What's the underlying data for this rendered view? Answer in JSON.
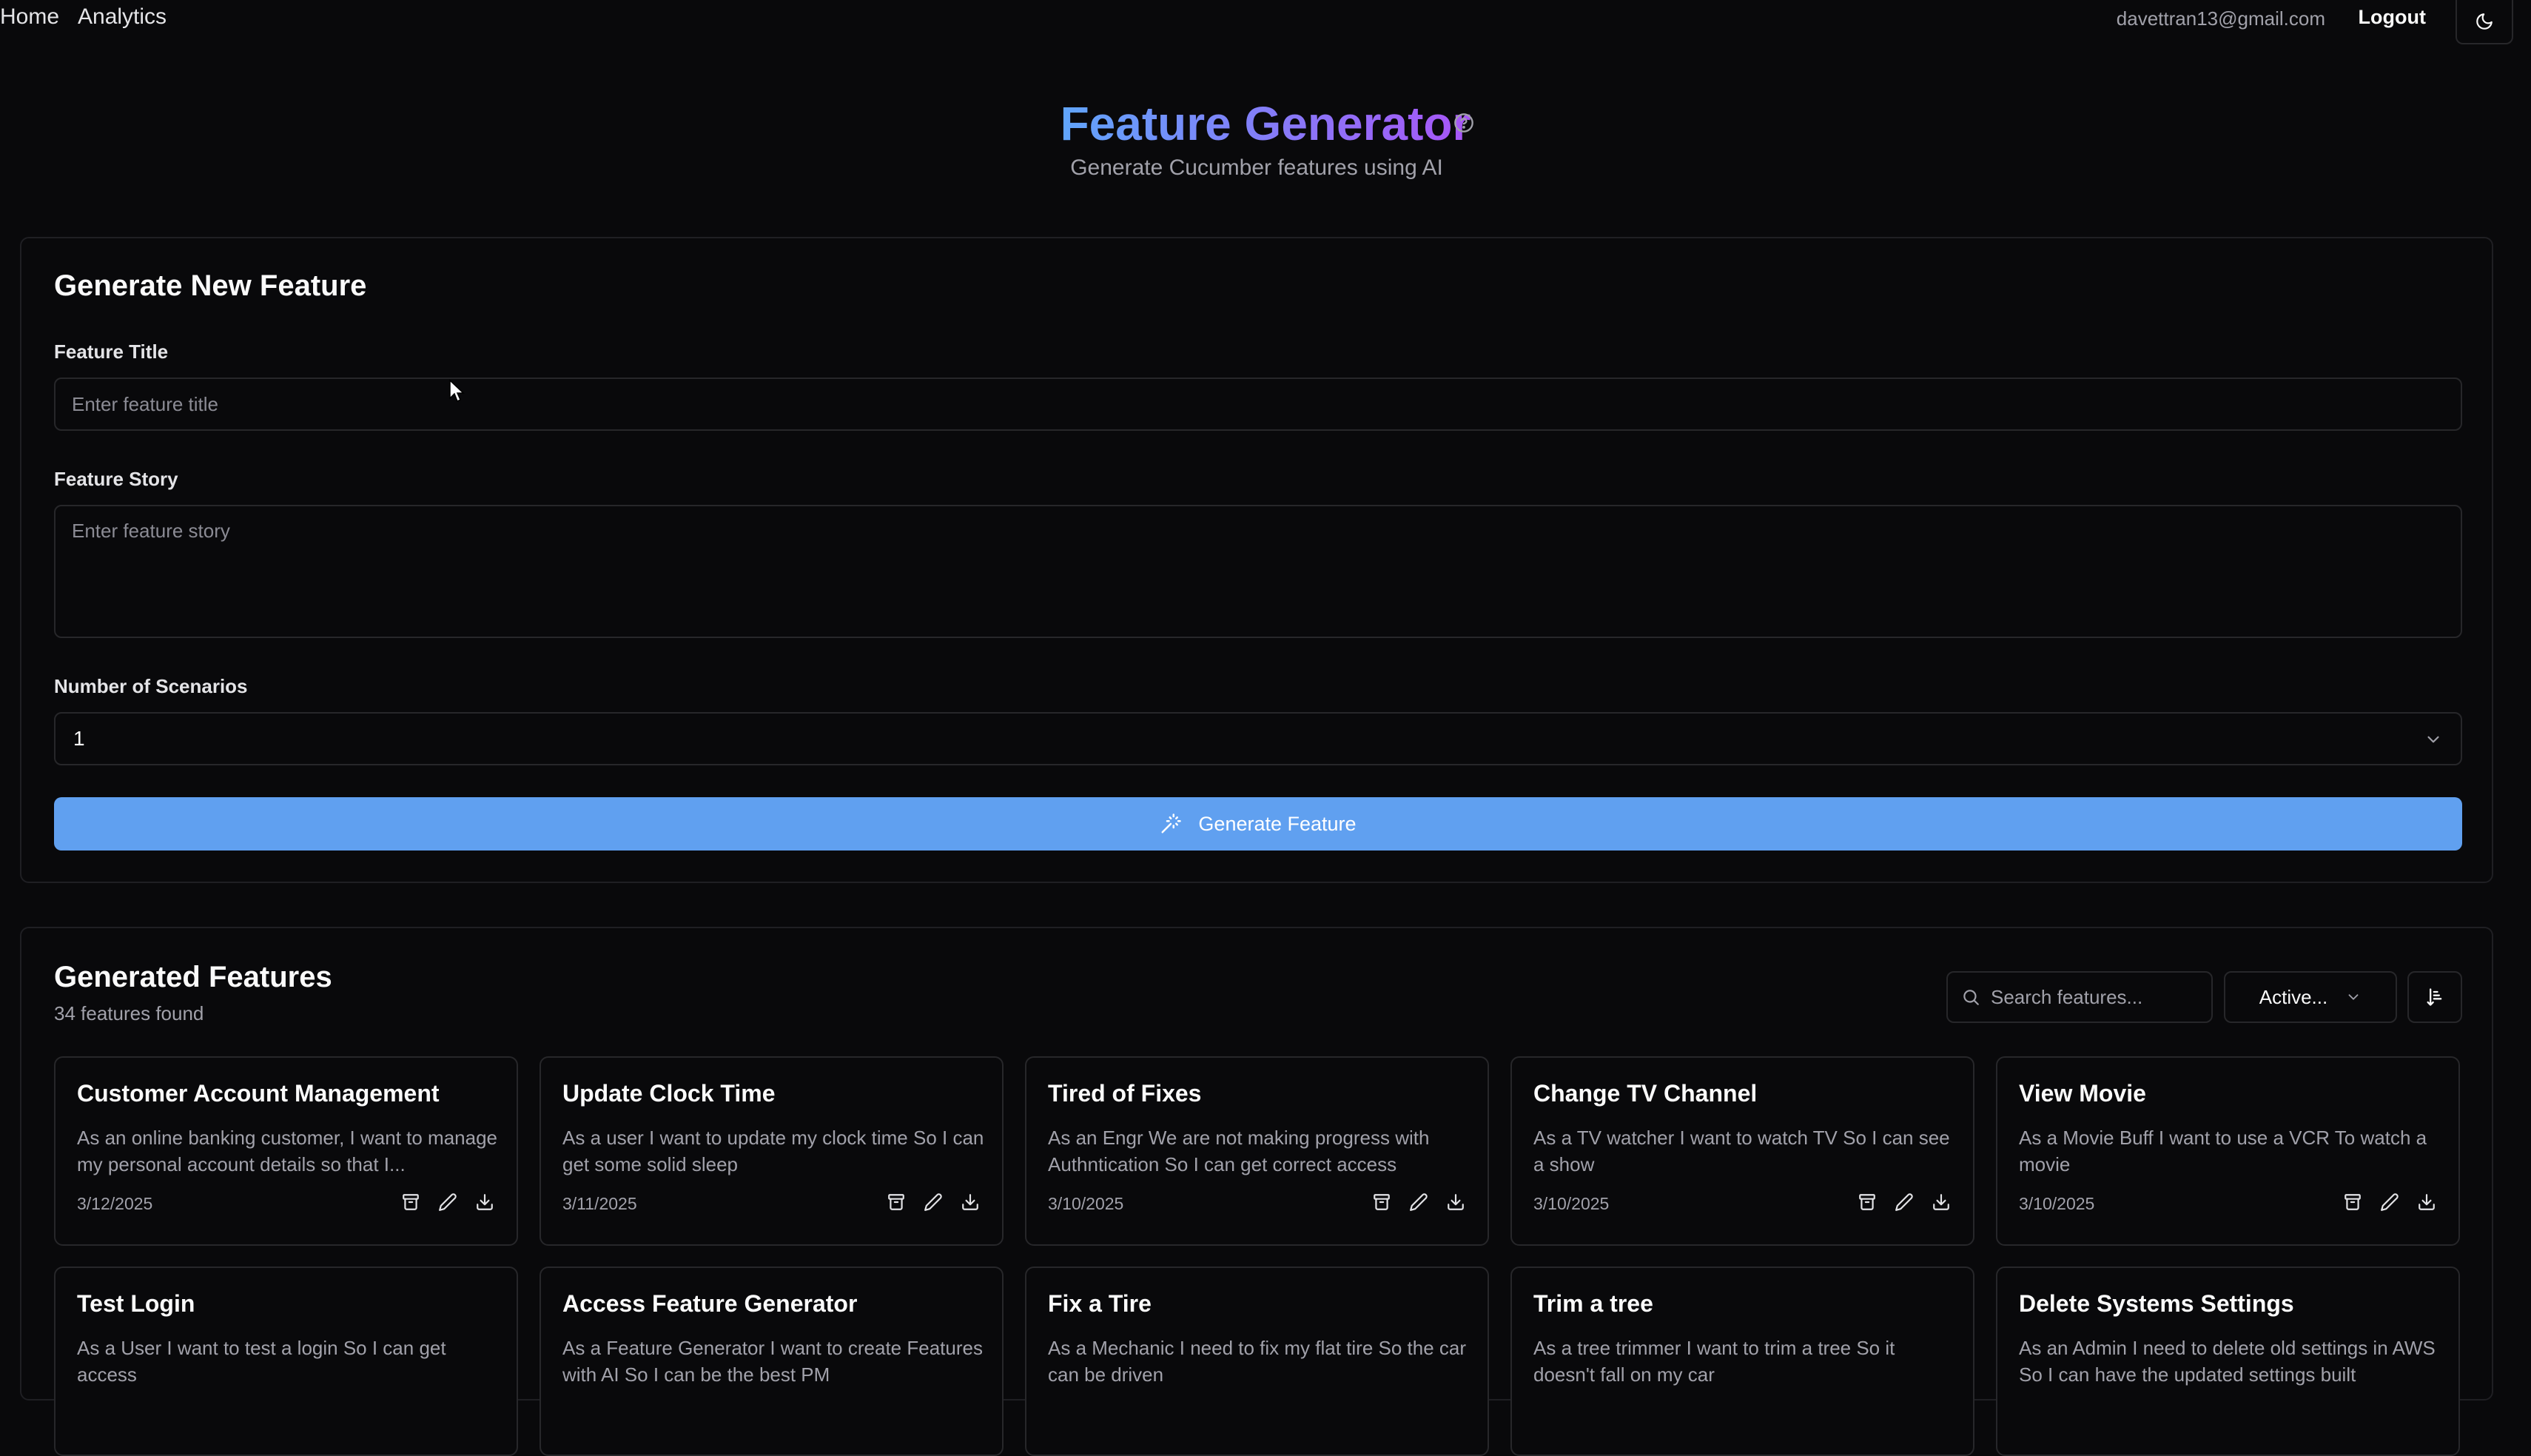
{
  "nav": {
    "home": "Home",
    "analytics": "Analytics",
    "email": "davettran13@gmail.com",
    "logout": "Logout",
    "theme_icon": "moon-icon"
  },
  "header": {
    "title": "Feature Generator",
    "subtitle": "Generate Cucumber features using AI",
    "help_icon": "help-circle-icon"
  },
  "form": {
    "heading": "Generate New Feature",
    "title_label": "Feature Title",
    "title_placeholder": "Enter feature title",
    "title_value": "",
    "story_label": "Feature Story",
    "story_placeholder": "Enter feature story",
    "story_value": "",
    "scenarios_label": "Number of Scenarios",
    "scenarios_value": "1",
    "generate_label": "Generate Feature"
  },
  "list": {
    "heading": "Generated Features",
    "count": "34 features found",
    "search_placeholder": "Search features...",
    "filter_value": "Active...",
    "features": [
      {
        "title": "Customer Account Management",
        "story": "As an online banking customer, I want to manage my personal account details so that I...",
        "date": "3/12/2025"
      },
      {
        "title": "Update Clock Time",
        "story": "As a user I want to update my clock time So I can get some solid sleep",
        "date": "3/11/2025"
      },
      {
        "title": "Tired of Fixes",
        "story": "As an Engr We are not making progress with Authntication So I can get correct access",
        "date": "3/10/2025"
      },
      {
        "title": "Change TV Channel",
        "story": "As a TV watcher I want to watch TV So I can see a show",
        "date": "3/10/2025"
      },
      {
        "title": "View Movie",
        "story": "As a Movie Buff I want to use a VCR To watch a movie",
        "date": "3/10/2025"
      },
      {
        "title": "Test Login",
        "story": "As a User I want to test a login So I can get access",
        "date": ""
      },
      {
        "title": "Access Feature Generator",
        "story": "As a Feature Generator I want to create Features with AI So I can be the best PM",
        "date": ""
      },
      {
        "title": "Fix a Tire",
        "story": "As a Mechanic I need to fix my flat tire So the car can be driven",
        "date": ""
      },
      {
        "title": "Trim a tree",
        "story": "As a tree trimmer I want to trim a tree So it doesn't fall on my car",
        "date": ""
      },
      {
        "title": "Delete Systems Settings",
        "story": "As an Admin I need to delete old settings in AWS So I can have the updated settings built",
        "date": ""
      }
    ]
  },
  "colors": {
    "background": "#09090b",
    "primary_button": "#60a0f0",
    "title_gradient_start": "#60a5fa",
    "title_gradient_end": "#a855f7"
  }
}
